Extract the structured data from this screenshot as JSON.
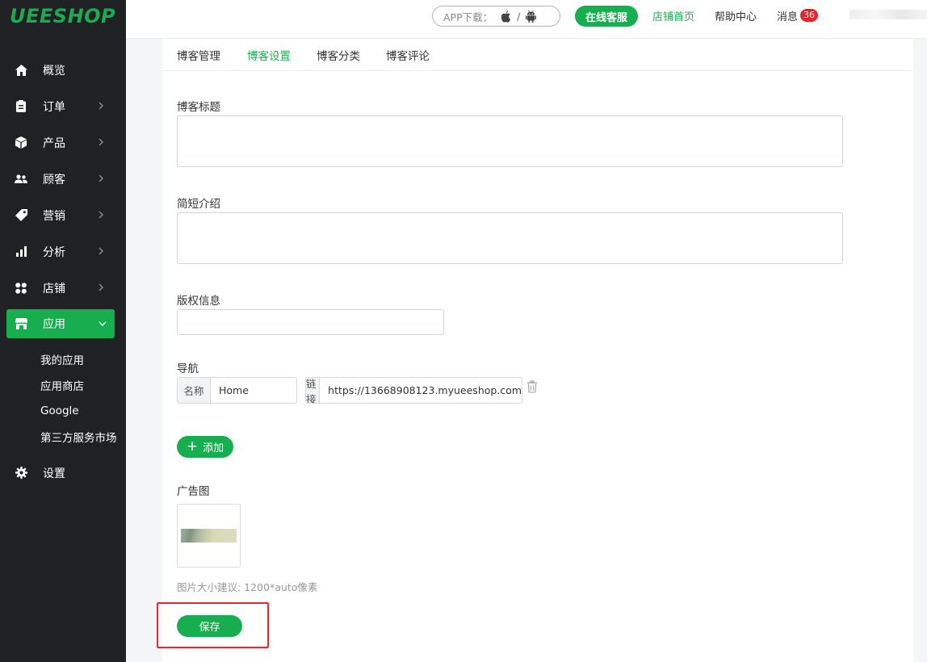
{
  "brand": {
    "logo": "UEESHOP",
    "accent": "#17ae4f"
  },
  "sidebar": {
    "items": [
      {
        "label": "概览",
        "icon": "home-icon"
      },
      {
        "label": "订单",
        "icon": "clipboard-icon"
      },
      {
        "label": "产品",
        "icon": "box-icon"
      },
      {
        "label": "顾客",
        "icon": "users-icon"
      },
      {
        "label": "营销",
        "icon": "tag-icon"
      },
      {
        "label": "分析",
        "icon": "bar-chart-icon"
      },
      {
        "label": "店铺",
        "icon": "apps-icon"
      },
      {
        "label": "应用",
        "icon": "store-icon"
      },
      {
        "label": "设置",
        "icon": "gear-icon"
      }
    ],
    "subitems": [
      "我的应用",
      "应用商店",
      "Google",
      "第三方服务市场"
    ]
  },
  "topbar": {
    "app_download": "APP下载：",
    "slash": "/",
    "online_service": "在线客服",
    "store_home": "店铺首页",
    "help_center": "帮助中心",
    "messages": "消息",
    "message_count": "36"
  },
  "tabs": [
    "博客管理",
    "博客设置",
    "博客分类",
    "博客评论"
  ],
  "form": {
    "title_label": "博客标题",
    "title_value": "",
    "intro_label": "简短介绍",
    "intro_value": "",
    "copyright_label": "版权信息",
    "copyright_value": "",
    "nav_label": "导航",
    "name_addon": "名称",
    "name_value": "Home",
    "link_addon": "链接",
    "link_value": "https://13668908123.myueeshop.com",
    "add_button": "添加",
    "ad_label": "广告图",
    "ad_hint": "图片大小建议: 1200*auto像素",
    "save_button": "保存"
  }
}
